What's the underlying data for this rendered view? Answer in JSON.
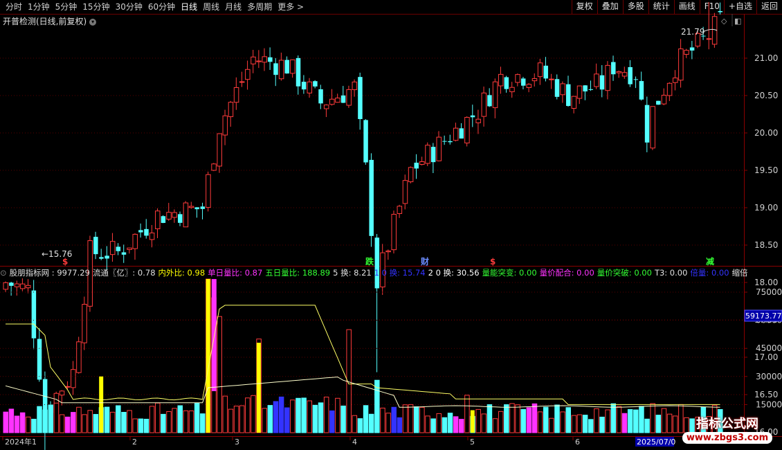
{
  "toolbar": {
    "periods": [
      "分时",
      "1分钟",
      "5分钟",
      "15分钟",
      "30分钟",
      "60分钟",
      "日线",
      "周线",
      "月线",
      "多周期",
      "更多 >"
    ],
    "active_period": "日线",
    "right_buttons": [
      "复权",
      "叠加",
      "多股",
      "统计",
      "画线",
      "F10",
      "+自选",
      "返回"
    ]
  },
  "main_panel": {
    "title": "开普检测(日线,前复权)",
    "high_label": "21.79",
    "low_label": "←15.76",
    "price_axis": [
      "21.00",
      "20.50",
      "20.00",
      "19.50",
      "19.00",
      "18.50",
      "18.00",
      "17.50",
      "17.00",
      "16.50",
      "16.00"
    ],
    "signals": [
      {
        "text": "$",
        "color": "#ff3b3b"
      },
      {
        "text": "跌",
        "color": "#33ff33"
      },
      {
        "text": "财",
        "color": "#6b8cff"
      },
      {
        "text": "$",
        "color": "#ff3b3b"
      },
      {
        "text": "减",
        "color": "#33ff33"
      }
    ]
  },
  "indicator_panel": {
    "items": [
      {
        "text": "股朋指标网 : 9977.29",
        "color": "#e0e0e0"
      },
      {
        "text": "流通〖亿〗: 0.78",
        "color": "#e0e0e0"
      },
      {
        "text": "内外比: 0.98",
        "color": "#ffff00"
      },
      {
        "text": "单日量比: 0.87",
        "color": "#ff33ff"
      },
      {
        "text": "五日量比: 188.89",
        "color": "#33ff33"
      },
      {
        "text": "5 换: 8.21",
        "color": "#e0e0e0"
      },
      {
        "text": "1 0 换: 15.74",
        "color": "#3333ff"
      },
      {
        "text": "2 0 换: 30.56",
        "color": "#ffffff"
      },
      {
        "text": "量能突变: 0.00",
        "color": "#33ff33"
      },
      {
        "text": "量价配合: 0.00",
        "color": "#ff33ff"
      },
      {
        "text": "量价突破: 0.00",
        "color": "#33ff33"
      },
      {
        "text": "T3: 0.00",
        "color": "#e0e0e0"
      },
      {
        "text": "倍量: 0.00",
        "color": "#3333ff"
      },
      {
        "text": "缩倍",
        "color": "#e0e0e0"
      }
    ],
    "vol_axis": [
      "75000",
      "60000",
      "45000",
      "30000",
      "15000"
    ],
    "current_value": "59173.77"
  },
  "date_axis": {
    "labels": [
      "2024年1",
      "2",
      "3",
      "4",
      "5",
      "6"
    ],
    "current_date": "2025/07/0"
  },
  "watermark": {
    "title": "指标公式网",
    "url": "www.zbgs3.com"
  },
  "colors": {
    "up": "#ff3b3b",
    "down": "#54ffff",
    "grid": "#5a0000",
    "axis_text": "#d0d0d0",
    "ma": "#ffff66"
  }
}
